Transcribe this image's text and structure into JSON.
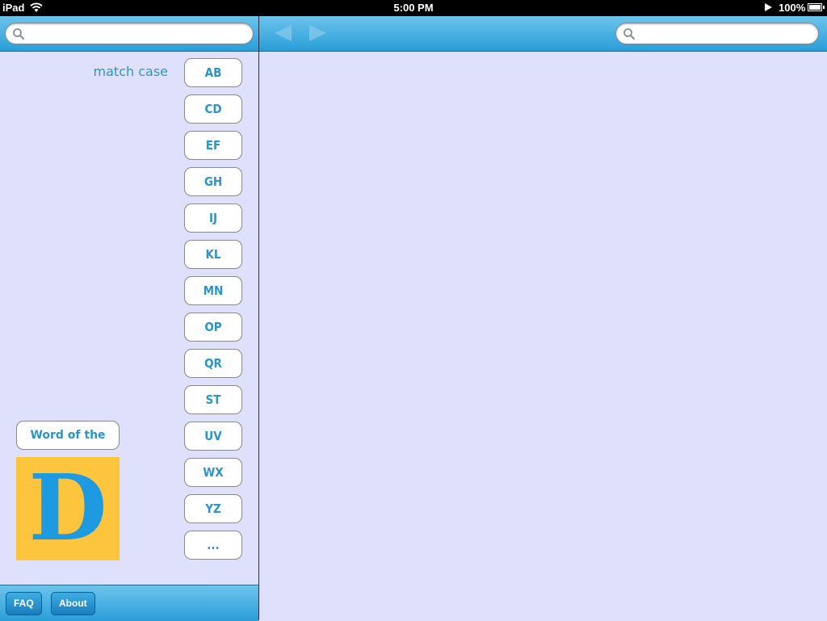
{
  "status_bar": {
    "carrier": "iPad",
    "time": "5:00 PM",
    "battery_percent": "100%",
    "icons": [
      "wifi-icon",
      "play-icon",
      "battery-icon"
    ]
  },
  "left_panel": {
    "search": {
      "placeholder": "",
      "value": ""
    },
    "match_case_label": "match case",
    "letter_buttons": [
      "AB",
      "CD",
      "EF",
      "GH",
      "IJ",
      "KL",
      "MN",
      "OP",
      "QR",
      "ST",
      "UV",
      "WX",
      "YZ",
      "..."
    ],
    "word_of_the_day": {
      "button_label": "Word of the Day",
      "tile_letter": "D"
    },
    "bottom_bar": {
      "faq_label": "FAQ",
      "about_label": "About"
    }
  },
  "right_panel": {
    "search": {
      "placeholder": "",
      "value": ""
    },
    "nav": {
      "back_enabled": false,
      "forward_enabled": false
    }
  },
  "colors": {
    "toolbar": "#2a9ed8",
    "background": "#dfe0fc",
    "accent_text": "#2b95c8",
    "tile_background": "#fdc43d",
    "tile_letter": "#1e9ae0"
  }
}
